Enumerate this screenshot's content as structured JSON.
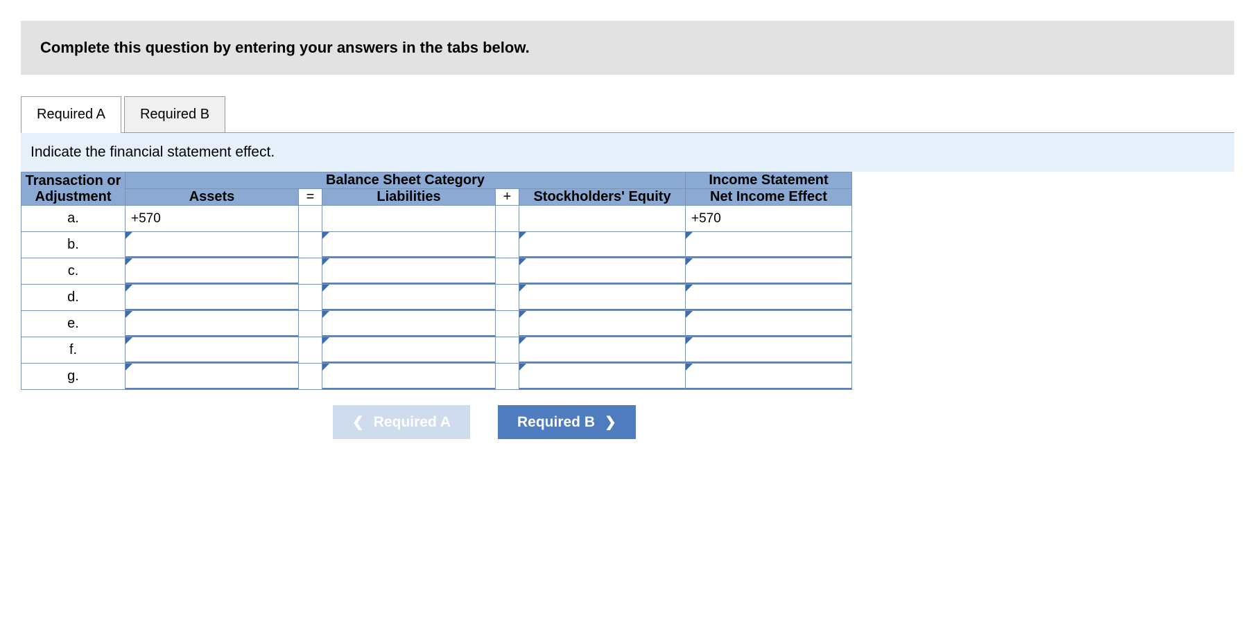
{
  "instruction": "Complete this question by entering your answers in the tabs below.",
  "tabs": {
    "a": "Required A",
    "b": "Required B"
  },
  "subinstruction": "Indicate the financial statement effect.",
  "headers": {
    "transaction": "Transaction or Adjustment",
    "balance_sheet": "Balance Sheet Category",
    "income_statement": "Income Statement",
    "assets": "Assets",
    "eq": "=",
    "liabilities": "Liabilities",
    "plus": "+",
    "stockholders": "Stockholders' Equity",
    "net_income": "Net Income Effect"
  },
  "rows": [
    {
      "label": "a.",
      "assets": "+570",
      "liab": "",
      "stock": "",
      "net": "+570",
      "marked": {
        "assets": false,
        "liab": false,
        "stock": false,
        "net": false
      }
    },
    {
      "label": "b.",
      "assets": "",
      "liab": "",
      "stock": "",
      "net": "",
      "marked": {
        "assets": true,
        "liab": true,
        "stock": true,
        "net": true
      }
    },
    {
      "label": "c.",
      "assets": "",
      "liab": "",
      "stock": "",
      "net": "",
      "marked": {
        "assets": true,
        "liab": true,
        "stock": true,
        "net": true
      }
    },
    {
      "label": "d.",
      "assets": "",
      "liab": "",
      "stock": "",
      "net": "",
      "marked": {
        "assets": true,
        "liab": true,
        "stock": true,
        "net": true
      }
    },
    {
      "label": "e.",
      "assets": "",
      "liab": "",
      "stock": "",
      "net": "",
      "marked": {
        "assets": true,
        "liab": true,
        "stock": true,
        "net": true
      }
    },
    {
      "label": "f.",
      "assets": "",
      "liab": "",
      "stock": "",
      "net": "",
      "marked": {
        "assets": true,
        "liab": true,
        "stock": true,
        "net": true
      }
    },
    {
      "label": "g.",
      "assets": "",
      "liab": "",
      "stock": "",
      "net": "",
      "marked": {
        "assets": true,
        "liab": true,
        "stock": true,
        "net": true
      }
    }
  ],
  "nav": {
    "prev": "Required A",
    "next": "Required B"
  }
}
